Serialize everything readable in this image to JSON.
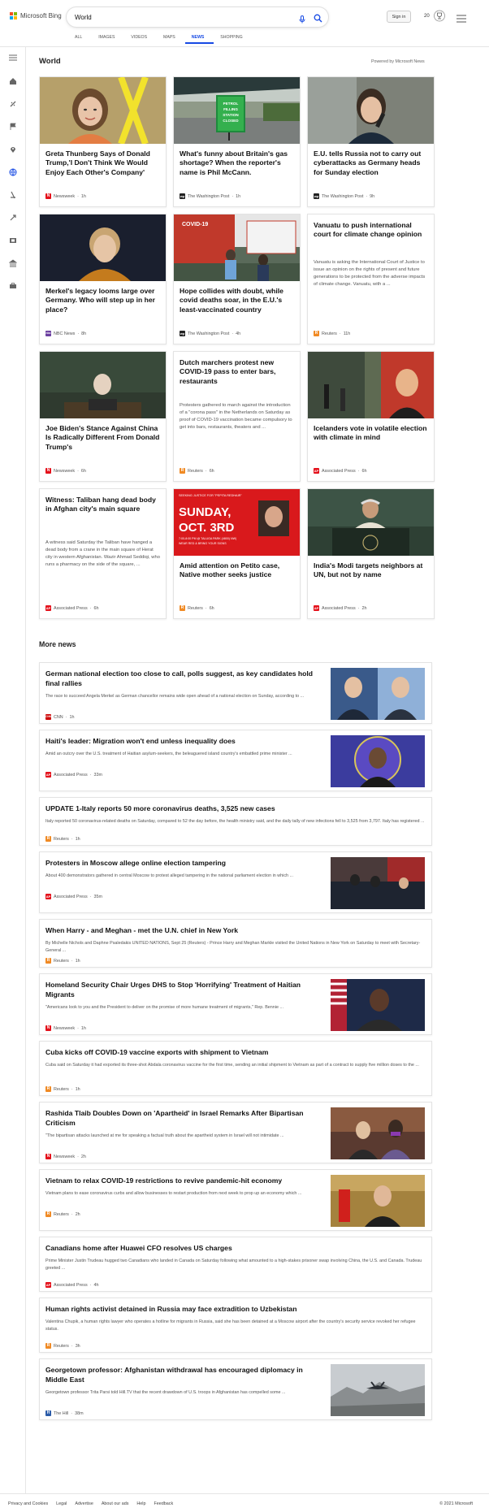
{
  "header": {
    "logo_text": "Microsoft Bing",
    "search_value": "World",
    "signin_label": "Sign in",
    "points": "20",
    "tabs": [
      {
        "label": "ALL"
      },
      {
        "label": "IMAGES"
      },
      {
        "label": "VIDEOS"
      },
      {
        "label": "MAPS"
      },
      {
        "label": "NEWS",
        "active": true
      },
      {
        "label": "SHOPPING"
      }
    ]
  },
  "rail_icons": [
    "home-icon",
    "sports-icon",
    "flag-icon",
    "location-icon",
    "globe-icon",
    "science-icon",
    "rocket-icon",
    "film-icon",
    "bank-icon",
    "briefcase-icon"
  ],
  "section": {
    "title": "World",
    "powered": "Powered by Microsoft News"
  },
  "cards": [
    {
      "title": "Greta Thunberg Says of Donald Trump,'I Don't Think We Would Enjoy Each Other's Company'",
      "source": "Newsweek",
      "time": "1h",
      "logo": "N",
      "logo_color": "#e4111b",
      "image": "greta"
    },
    {
      "title": "What's funny about Britain's gas shortage? When the reporter's name is Phil McCann.",
      "source": "The Washington Post",
      "time": "1h",
      "logo": "wp",
      "logo_color": "#222222",
      "image": "station",
      "sign_text": "PETROL FILLING STATION CLOSED"
    },
    {
      "title": "E.U. tells Russia not to carry out cyberattacks as Germany heads for Sunday election",
      "source": "The Washington Post",
      "time": "9h",
      "logo": "wp",
      "logo_color": "#222222",
      "image": "speaker"
    },
    {
      "title": "Merkel's legacy looms large over Germany. Who will step up in her place?",
      "source": "NBC News",
      "time": "8h",
      "logo": "nbc",
      "logo_color": "#6b3fa0",
      "image": "merkel"
    },
    {
      "title": "Hope collides with doubt, while covid deaths soar, in the E.U.'s least-vaccinated country",
      "source": "The Washington Post",
      "time": "4h",
      "logo": "wp",
      "logo_color": "#222222",
      "image": "covid",
      "sign_text": "COVID-19"
    },
    {
      "title": "Vanuatu to push international court for climate change opinion",
      "desc": "Vanuatu is asking the International Court of Justice to issue an opinion on the rights of present and future generations to be protected from the adverse impacts of climate change. Vanuatu, with a ...",
      "source": "Reuters",
      "time": "11h",
      "logo": "R",
      "logo_color": "#f08a24",
      "image": "none"
    },
    {
      "title": "Joe Biden's Stance Against China Is Radically Different From Donald Trump's",
      "source": "Newsweek",
      "time": "6h",
      "logo": "N",
      "logo_color": "#e4111b",
      "image": "un"
    },
    {
      "title": "Dutch marchers protest new COVID-19 pass to enter bars, restaurants",
      "desc": "Protesters gathered to march against the introduction of a \"corona pass\" in the Netherlands on Saturday as proof of COVID-19 vaccination became compulsory to get into bars, restaurants, theaters and ...",
      "source": "Reuters",
      "time": "6h",
      "logo": "R",
      "logo_color": "#f08a24",
      "image": "none"
    },
    {
      "title": "Icelanders vote in volatile election with climate in mind",
      "source": "Associated Press",
      "time": "6h",
      "logo": "AP",
      "logo_color": "#e4111b",
      "image": "iceland"
    },
    {
      "title": "Witness: Taliban hang dead body in Afghan city's main square",
      "desc": "A witness said Saturday the Taliban have hanged a dead body from a crane in the main square of Herat city in western Afghanistan. Wazir Ahmad Seddiqi, who runs a pharmacy on the side of the square, ...",
      "source": "Associated Press",
      "time": "6h",
      "logo": "AP",
      "logo_color": "#e4111b",
      "image": "none"
    },
    {
      "title": "Amid attention on Petito case, Native mother seeks justice",
      "source": "Reuters",
      "time": "6h",
      "logo": "R",
      "logo_color": "#f08a24",
      "image": "poster",
      "poster_top": "SEEKING JUSTICE FOR \"PEPITA REDHAIR\"",
      "poster_main1": "SUNDAY,",
      "poster_main2": "OCT. 3RD",
      "poster_sub1": "7:00-8:00 PM @ TALUGA PARK (4800) NW)",
      "poster_sub2": "WEAR RED & BRING YOUR SIGNS"
    },
    {
      "title": "India's Modi targets neighbors at UN, but not by name",
      "source": "Associated Press",
      "time": "2h",
      "logo": "AP",
      "logo_color": "#e4111b",
      "image": "modi"
    }
  ],
  "more_news": {
    "title": "More news",
    "items": [
      {
        "title": "German national election too close to call, polls suggest, as key candidates hold final rallies",
        "desc": "The race to succeed Angela Merkel as German chancellor remains wide open ahead of a national election on Sunday, according to ...",
        "source": "CNN",
        "time": "1h",
        "logo": "CNN",
        "logo_color": "#cc0000",
        "thumb": "german"
      },
      {
        "title": "Haiti's leader: Migration won't end unless inequality does",
        "desc": "Amid an outcry over the U.S. treatment of Haitian asylum-seekers, the beleaguered island country's embattled prime minister ...",
        "source": "Associated Press",
        "time": "33m",
        "logo": "AP",
        "logo_color": "#e4111b",
        "thumb": "haiti"
      },
      {
        "title": "UPDATE 1-Italy reports 50 more coronavirus deaths, 3,525 new cases",
        "desc": "Italy reported 50 coronavirus-related deaths on Saturday, compared to 52 the day before, the health ministry said, and the daily tally of new infections fell to 3,525 from 3,797. Italy has registered ...",
        "source": "Reuters",
        "time": "1h",
        "logo": "R",
        "logo_color": "#f08a24",
        "thumb": "none"
      },
      {
        "title": "Protesters in Moscow allege online election tampering",
        "desc": "About 400 demonstrators gathered in central Moscow to protest alleged tampering in the national parliament election in which ...",
        "source": "Associated Press",
        "time": "35m",
        "logo": "AP",
        "logo_color": "#e4111b",
        "thumb": "moscow"
      },
      {
        "title": "When Harry - and Meghan - met the U.N. chief in New York",
        "desc": "By Michelle Nichols and Daphne Psaledakis UNITED NATIONS, Sept 25 (Reuters) - Prince Harry and Meghan Markle visited the United Nations in New York on Saturday to meet with Secretary-General ...",
        "source": "Reuters",
        "time": "1h",
        "logo": "R",
        "logo_color": "#f08a24",
        "thumb": "none"
      },
      {
        "title": "Homeland Security Chair Urges DHS to Stop 'Horrifying' Treatment of Haitian Migrants",
        "desc": "\"Americans look to you and the President to deliver on the promise of more humane treatment of migrants,\" Rep. Bennie ...",
        "source": "Newsweek",
        "time": "1h",
        "logo": "N",
        "logo_color": "#e4111b",
        "thumb": "homeland"
      },
      {
        "title": "Cuba kicks off COVID-19 vaccine exports with shipment to Vietnam",
        "desc": "Cuba said on Saturday it had exported its three-shot Abdala coronavirus vaccine for the first time, sending an initial shipment to Vietnam as part of a contract to supply five million doses to the ...",
        "source": "Reuters",
        "time": "1h",
        "logo": "R",
        "logo_color": "#f08a24",
        "thumb": "none"
      },
      {
        "title": "Rashida Tlaib Doubles Down on 'Apartheid' in Israel Remarks After Bipartisan Criticism",
        "desc": "\"The bipartisan attacks launched at me for speaking a factual truth about the apartheid system in Israel will not intimidate ...",
        "source": "Newsweek",
        "time": "2h",
        "logo": "N",
        "logo_color": "#e4111b",
        "thumb": "tlaib"
      },
      {
        "title": "Vietnam to relax COVID-19 restrictions to revive pandemic-hit economy",
        "desc": "Vietnam plans to ease coronavirus curbs and allow businesses to restart production from next week to prop up an economy which ...",
        "source": "Reuters",
        "time": "2h",
        "logo": "R",
        "logo_color": "#f08a24",
        "thumb": "vietnam"
      },
      {
        "title": "Canadians home after Huawei CFO resolves US charges",
        "desc": "Prime Minister Justin Trudeau hugged two Canadians who landed in Canada on Saturday following what amounted to a high-stakes prisoner swap involving China, the U.S. and Canada. Trudeau greeted ...",
        "source": "Associated Press",
        "time": "4h",
        "logo": "AP",
        "logo_color": "#e4111b",
        "thumb": "none"
      },
      {
        "title": "Human rights activist detained in Russia may face extradition to Uzbekistan",
        "desc": "Valentina Chupik, a human rights lawyer who operates a hotline for migrants in Russia, said she has been detained at a Moscow airport after the country's security service revoked her refugee status.",
        "source": "Reuters",
        "time": "3h",
        "logo": "R",
        "logo_color": "#f08a24",
        "thumb": "none"
      },
      {
        "title": "Georgetown professor: Afghanistan withdrawal has encouraged diplomacy in Middle East",
        "desc": "Georgetown professor Trita Parsi told Hill.TV that the recent drawdown of U.S. troops in Afghanistan has compelled some ...",
        "source": "The Hill",
        "time": "38m",
        "logo": "H",
        "logo_color": "#2b5ba8",
        "thumb": "plane"
      }
    ]
  },
  "footer": {
    "links": [
      "Privacy and Cookies",
      "Legal",
      "Advertise",
      "About our ads",
      "Help",
      "Feedback"
    ],
    "copyright": "© 2021 Microsoft"
  },
  "colors": {
    "accent": "#174ae4",
    "bing_teal": "#00809d"
  }
}
